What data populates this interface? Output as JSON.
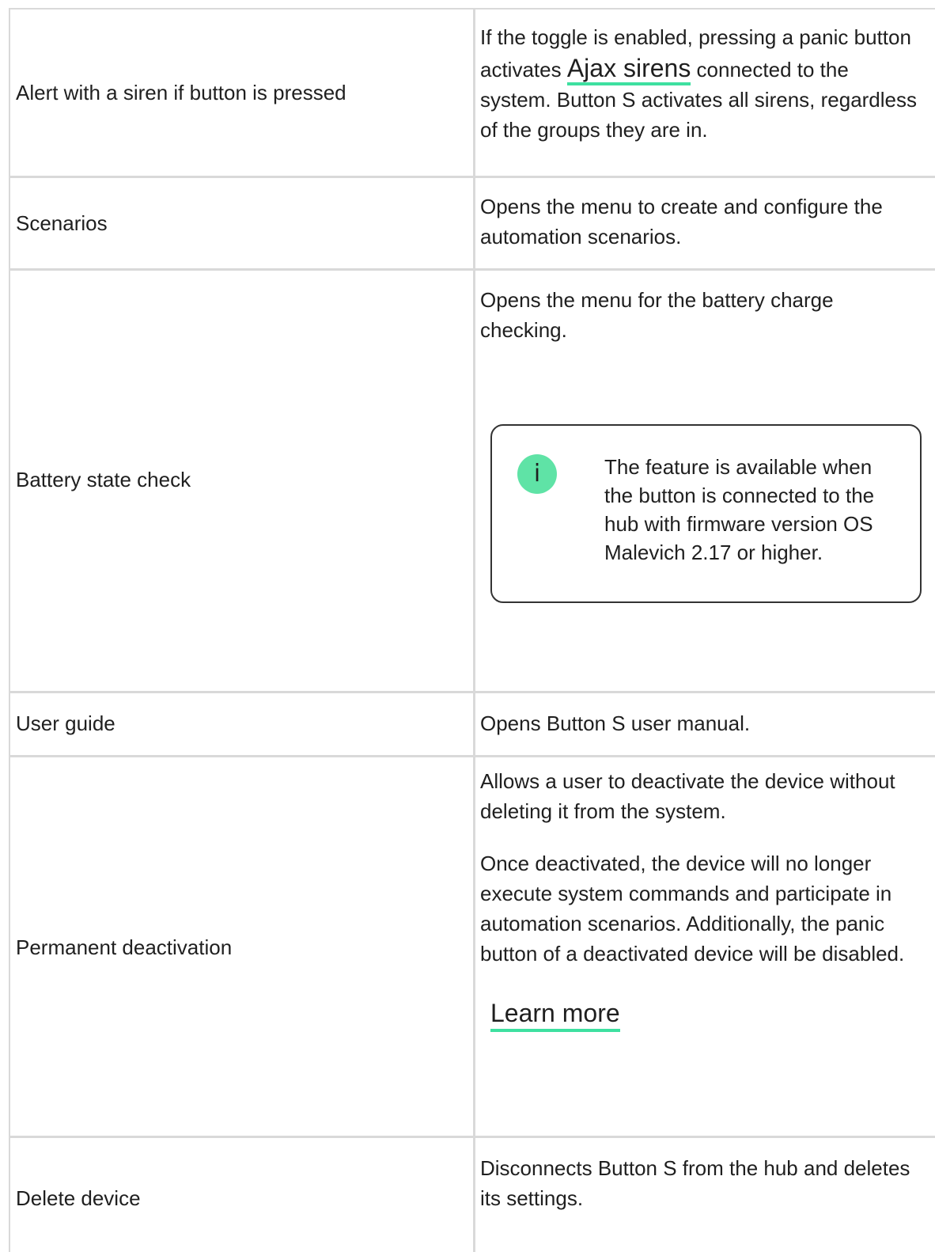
{
  "rows": [
    {
      "label": "Alert with a siren if button is pressed",
      "desc_before": "If the toggle is enabled, pressing a panic button activates ",
      "desc_link": "Ajax sirens",
      "desc_after": " connected to the system. Button S activates all sirens, regardless of the groups they are in."
    },
    {
      "label": "Scenarios",
      "desc": "Opens the menu to create and configure the automation scenarios."
    },
    {
      "label": "Battery state check",
      "desc": "Opens the menu for the battery charge checking.",
      "notice": {
        "icon": "info-icon",
        "icon_glyph": "i",
        "text": "The feature is available when the button is connected to the hub with firmware version OS Malevich 2.17 or higher."
      }
    },
    {
      "label": "User guide",
      "desc": "Opens Button S user manual."
    },
    {
      "label": "Permanent deactivation",
      "desc_p1": "Allows a user to deactivate the device without deleting it from the system.",
      "desc_p2": "Once deactivated, the device will no longer execute system commands and participate in automation scenarios. Additionally, the panic button of a deactivated device will be disabled.",
      "link": "Learn more"
    },
    {
      "label": "Delete device",
      "desc": "Disconnects Button S from the hub and deletes its settings."
    }
  ],
  "colors": {
    "border": "#d9d9d9",
    "accent": "#3ee0a0",
    "icon_bg": "#5fe3a6",
    "text": "#1f1f1f"
  }
}
